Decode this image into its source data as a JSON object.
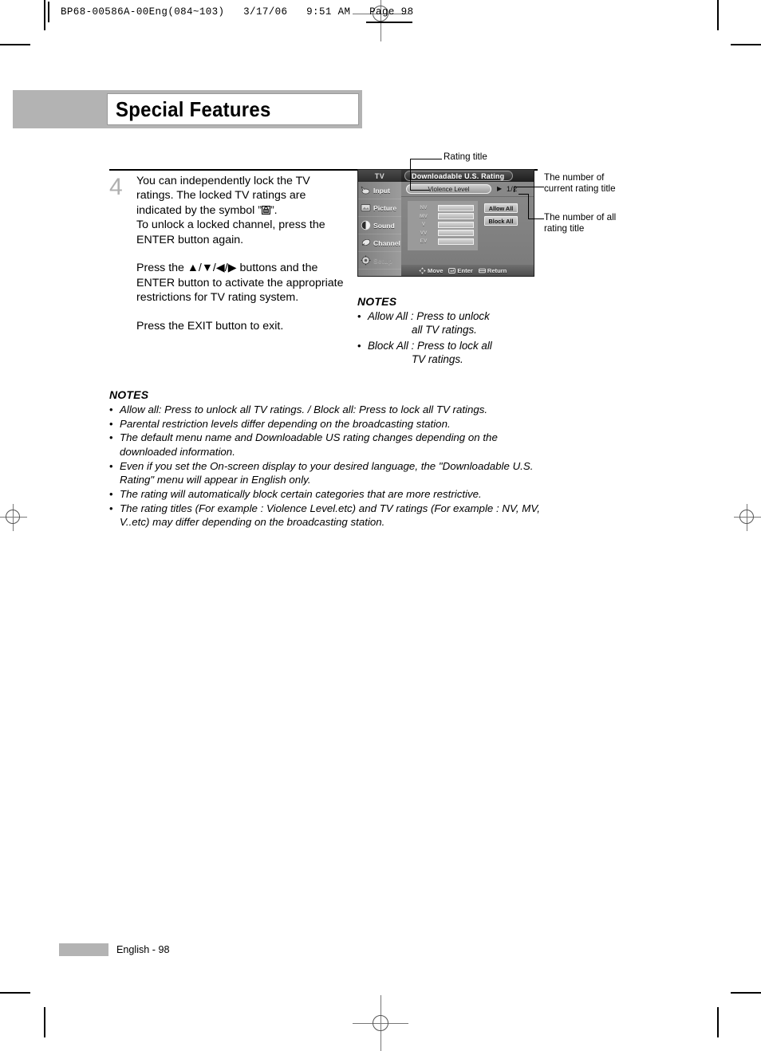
{
  "print_header": {
    "meta": "BP68-00586A-00Eng(084~103)   3/17/06   9:51 AM   Page 98"
  },
  "title_banner": {
    "title": "Special Features"
  },
  "step": {
    "number": "4",
    "para1_a": "You can independently lock the TV ratings. The locked TV ratings are indicated by the symbol ”",
    "para1_b": "”. To unlock a locked channel, press the ENTER button again.",
    "para1_line1": "You can independently lock the TV",
    "para1_line2": "ratings. The locked TV ratings are",
    "para1_line3_pre": "indicated by the symbol ”",
    "para1_line3_post": "”.",
    "para1_line4": "To unlock a locked channel, press the",
    "para1_line5": "ENTER button again.",
    "para2": "Press the ▲/▼/◀/▶ buttons and the ENTER button to activate the appropriate restrictions for TV rating system.",
    "para3": "Press the EXIT button to exit."
  },
  "tv_menu": {
    "sidebar_header": "TV",
    "sidebar_items": [
      {
        "label": "Input",
        "icon": "input-icon",
        "dim": false
      },
      {
        "label": "Picture",
        "icon": "picture-icon",
        "dim": false
      },
      {
        "label": "Sound",
        "icon": "sound-icon",
        "dim": false
      },
      {
        "label": "Channel",
        "icon": "channel-icon",
        "dim": false
      },
      {
        "label": "Setup",
        "icon": "setup-icon",
        "dim": true
      }
    ],
    "title": "Downloadable U.S. Rating",
    "rating_title": "Violence Level",
    "arrow": "▶",
    "page_count": "1/2",
    "ratings": [
      "NV",
      "MV",
      "V",
      "VV",
      "EV"
    ],
    "allow_all": "Allow All",
    "block_all": "Block All",
    "footer": [
      {
        "label": "Move",
        "icon": "dpad-icon"
      },
      {
        "label": "Enter",
        "icon": "enter-icon"
      },
      {
        "label": "Return",
        "icon": "return-icon"
      }
    ]
  },
  "callouts": {
    "rating_title": "Rating title",
    "current_number": "The number of current rating title",
    "all_number": "The number of all rating title"
  },
  "notes_right": {
    "heading": "NOTES",
    "items": [
      {
        "line1": "Allow All : Press to unlock",
        "line2": "all TV ratings."
      },
      {
        "line1": "Block All :  Press to lock all",
        "line2": "TV ratings."
      }
    ]
  },
  "notes_main": {
    "heading": "NOTES",
    "items": [
      "Allow all: Press to unlock all TV ratings. / Block all: Press to lock all TV ratings.",
      "Parental restriction levels differ depending on the broadcasting station.",
      "The default menu name and Downloadable US rating changes depending on the downloaded information.",
      "Even if you set the On-screen display to your desired language, the \"Downloadable U.S. Rating\" menu will appear in English only.",
      "The rating will automatically block certain categories that are more restrictive.",
      "The rating titles (For example : Violence Level.etc) and TV ratings (For example : NV, MV, V..etc) may differ depending on the broadcasting station."
    ]
  },
  "page_footer": {
    "label": "English - 98"
  },
  "colors": {
    "banner_gray": "#b3b3b3",
    "step_number_gray": "#b0b0b0"
  }
}
